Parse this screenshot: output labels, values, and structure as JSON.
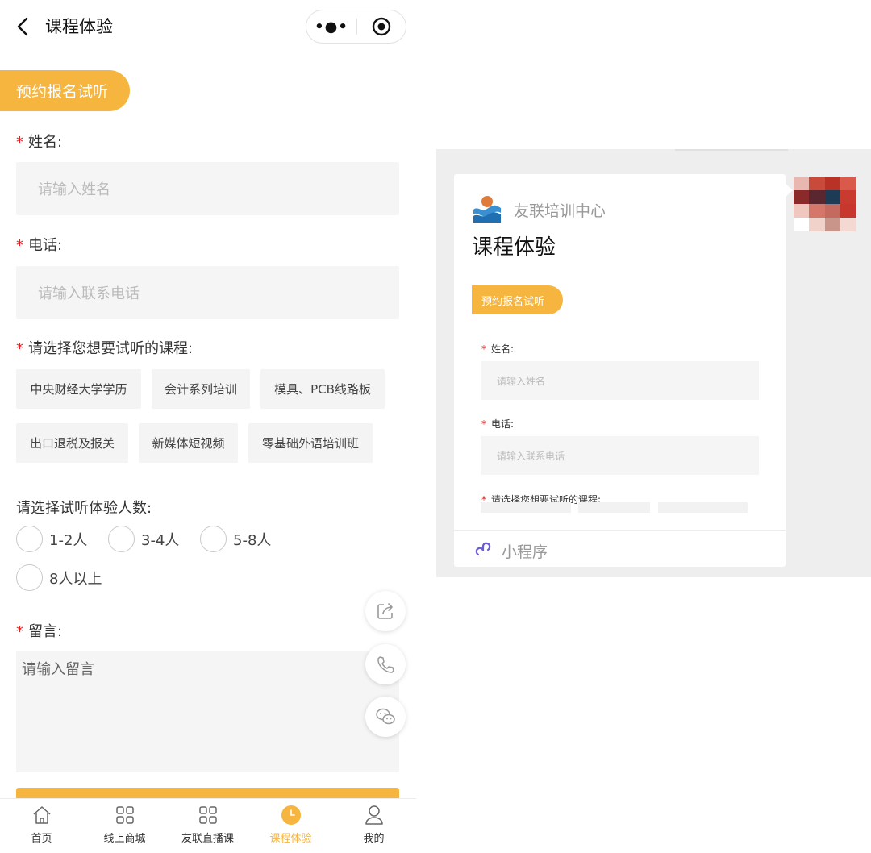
{
  "navbar": {
    "title": "课程体验",
    "more_glyph": "•●•"
  },
  "banner": {
    "label": "预约报名试听"
  },
  "form": {
    "name_label": "姓名:",
    "name_placeholder": "请输入姓名",
    "phone_label": "电话:",
    "phone_placeholder": "请输入联系电话",
    "course_label": "请选择您想要试听的课程:",
    "courses": [
      "中央财经大学学历",
      "会计系列培训",
      "模具、PCB线路板",
      "出口退税及报关",
      "新媒体短视频",
      "零基础外语培训班"
    ],
    "people_label": "请选择试听体验人数:",
    "people_options": [
      "1-2人",
      "3-4人",
      "5-8人",
      "8人以上"
    ],
    "message_label": "留言:",
    "message_placeholder": "请输入留言",
    "required_mark": "*"
  },
  "tabbar": {
    "items": [
      {
        "label": "首页",
        "icon": "home-icon"
      },
      {
        "label": "线上商城",
        "icon": "grid-icon"
      },
      {
        "label": "友联直播课",
        "icon": "grid-icon"
      },
      {
        "label": "课程体验",
        "icon": "clock-icon"
      },
      {
        "label": "我的",
        "icon": "user-icon"
      }
    ],
    "active": "课程体验"
  },
  "share_card": {
    "org_name": "友联培训中心",
    "title": "课程体验",
    "preview_banner": "预约报名试听",
    "preview_name_label": "姓名:",
    "preview_name_placeholder": "请输入姓名",
    "preview_phone_label": "电话:",
    "preview_phone_placeholder": "请输入联系电话",
    "preview_course_label": "请选择您想要试听的课程:",
    "footer_label": "小程序"
  },
  "colors": {
    "accent": "#f5b53f",
    "required": "#e02020",
    "input_bg": "#f5f5f5"
  }
}
